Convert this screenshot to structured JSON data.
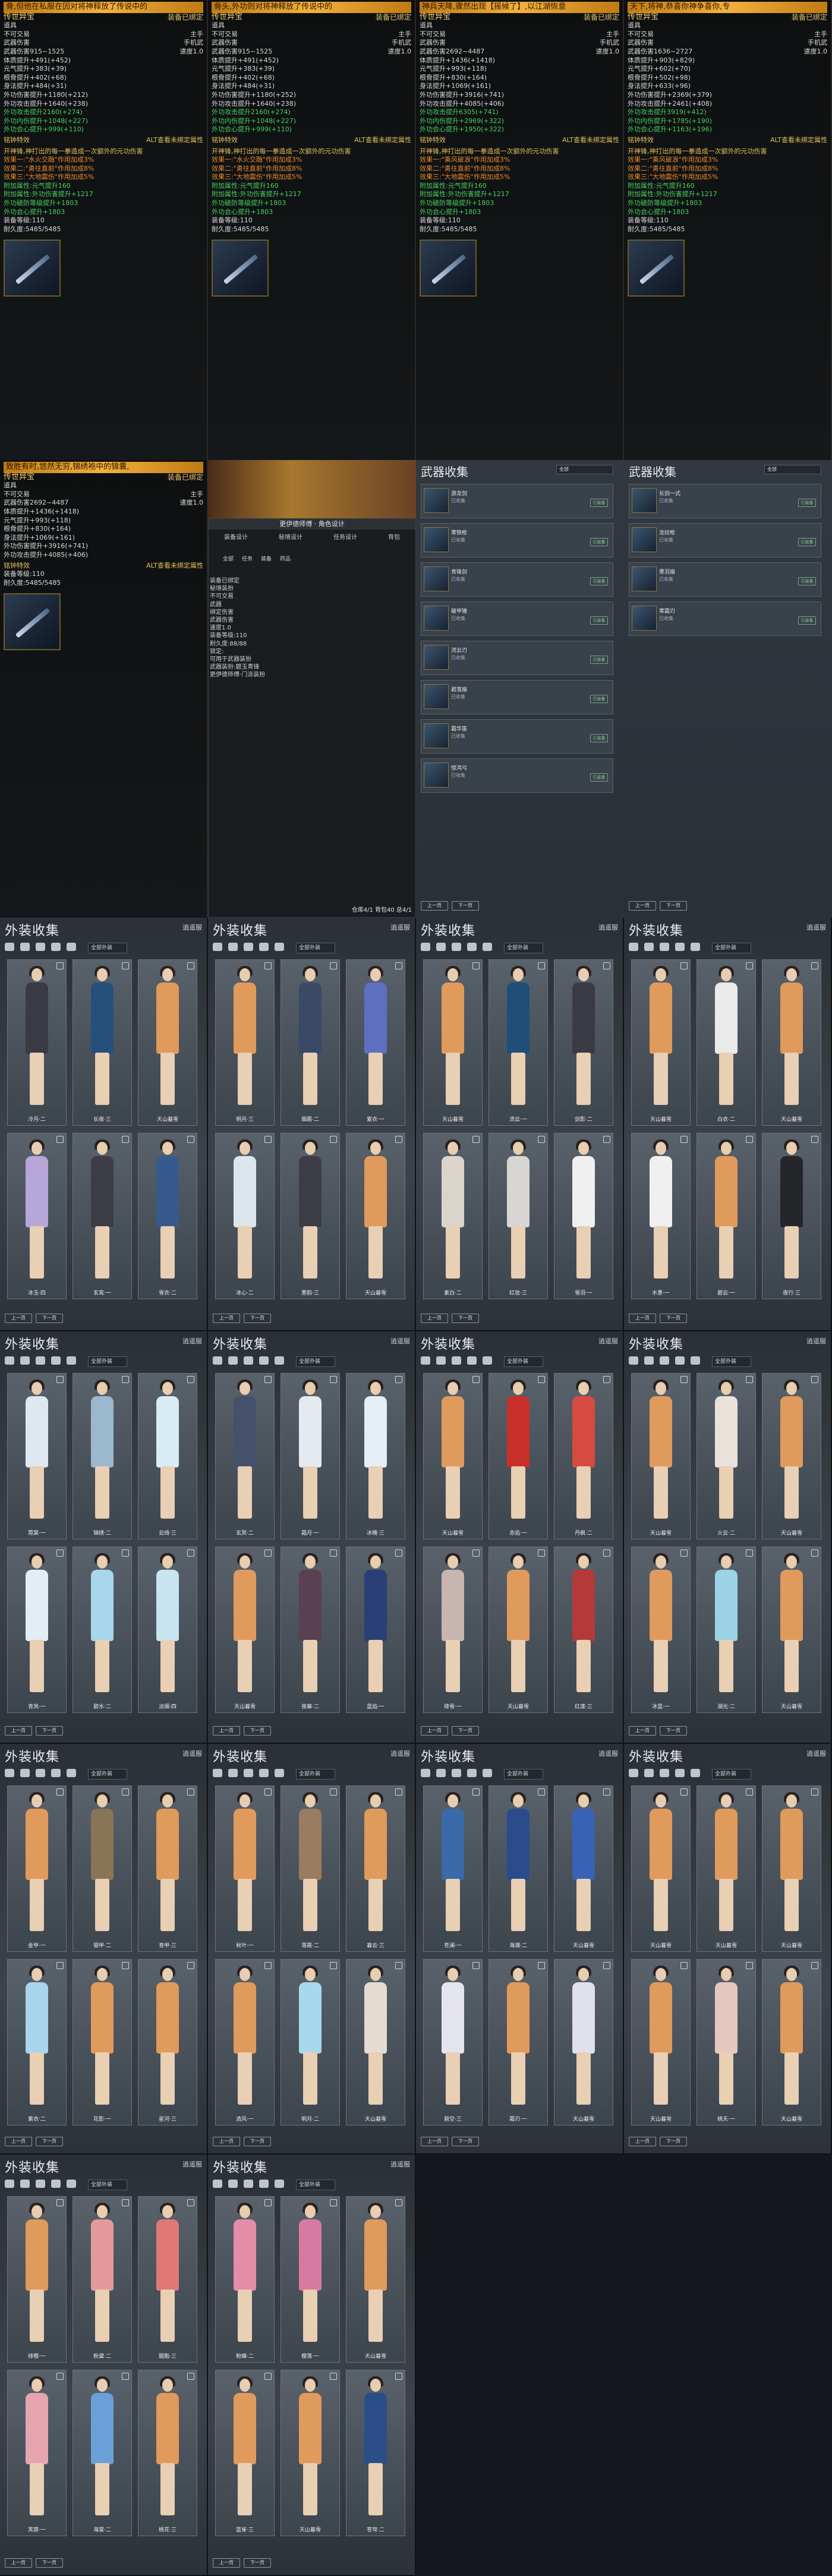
{
  "tooltips": [
    {
      "banner": "骨,但他在私服在因对将神释放了传说中的",
      "class": "传世异宝",
      "seal": "装备已绑定",
      "kind": "道具",
      "bind": "不可交易",
      "slot": "主手",
      "type": "手机武",
      "weapon_label": "武器伤害",
      "weapon_val": "武器伤害915~1525",
      "speed": "速度1.0",
      "stats": [
        "体质提升+491(+452)",
        "元气提升+383(+39)",
        "根骨提升+402(+68)",
        "身法提升+484(+31)",
        "外功伤害提升+1180(+212)",
        "外功攻击提升+1640(+238)"
      ],
      "green": [
        "外功攻击提升2160(+274)",
        "外功内伤提升+1048(+227)",
        "外功会心提升+999(+110)"
      ],
      "sect_l": "铭钟特效",
      "sect_r": "ALT查看未绑定属性",
      "desc": "开神锋,神打出的每一拳造成一次额外的元功伤害",
      "eff": [
        "效果一:\"水火交融\"作用加成3%",
        "效果二:\"勇往直前\"作用加成8%",
        "效果三:\"大地震伤\"作用加成5%"
      ],
      "attr": [
        "附加属性:元气提升160",
        "附加属性:外功伤害提升+1217",
        "外功破防等级提升+1803",
        "外功会心提升+1803"
      ],
      "dur": "耐久度:5485/5485",
      "lvl": "装备等级:110"
    },
    {
      "banner": "骨头,外功则对将神释放了传说中的",
      "class": "传世异宝",
      "seal": "装备已绑定",
      "kind": "道具",
      "bind": "不可交易",
      "slot": "主手",
      "type": "手机武",
      "weapon_label": "武器伤害",
      "weapon_val": "武器伤害915~1525",
      "speed": "速度1.0",
      "stats": [
        "体质提升+491(+452)",
        "元气提升+383(+39)",
        "根骨提升+402(+68)",
        "身法提升+484(+31)",
        "外功伤害提升+1180(+252)",
        "外功攻击提升+1640(+238)"
      ],
      "green": [
        "外功攻击提升2160(+274)",
        "外功内伤提升+1048(+227)",
        "外功会心提升+999(+110)"
      ],
      "sect_l": "铭钟特效",
      "sect_r": "ALT查看未绑定属性",
      "desc": "开神锋,神打出的每一拳造成一次额外的元功伤害",
      "eff": [
        "效果一:\"水火交融\"作用加成3%",
        "效果二:\"勇往直前\"作用加成8%",
        "效果三:\"大地震伤\"作用加成5%"
      ],
      "attr": [
        "附加属性:元气提升160",
        "附加属性:外功伤害提升+1217",
        "外功破防等级提升+1803",
        "外功会心提升+1803"
      ],
      "dur": "耐久度:5485/5485",
      "lvl": "装备等级:110"
    },
    {
      "banner": "神兵天降,骤然出现【摇候了】,以江湖恢意",
      "class": "传世异宝",
      "seal": "装备已绑定",
      "kind": "道具",
      "bind": "不可交易",
      "slot": "主手",
      "type": "手机武",
      "weapon_label": "武器伤害",
      "weapon_val": "武器伤害2692~4487",
      "speed": "速度1.0",
      "stats": [
        "体质提升+1436(+1418)",
        "元气提升+993(+118)",
        "根骨提升+830(+164)",
        "身法提升+1069(+161)",
        "外功伤害提升+3916(+741)",
        "外功攻击提升+4085(+406)"
      ],
      "green": [
        "外功攻击提升6305(+741)",
        "外功内伤提升+2969(+322)",
        "外功会心提升+1950(+322)"
      ],
      "sect_l": "铭钟特效",
      "sect_r": "ALT查看未绑定属性",
      "desc": "开神锋,神打出的每一拳造成一次额外的元功伤害",
      "eff": [
        "效果一:\"乘风破浪\"作用加成3%",
        "效果二:\"勇往直前\"作用加成8%",
        "效果三:\"大地震伤\"作用加成5%"
      ],
      "attr": [
        "附加属性:元气提升160",
        "附加属性:外功伤害提升+1217",
        "外功破防等级提升+1803",
        "外功会心提升+1803"
      ],
      "dur": "耐久度:5485/5485",
      "lvl": "装备等级:110"
    },
    {
      "banner": "天下,将神,恭喜你神争喜你,专",
      "class": "传世异宝",
      "seal": "装备已绑定",
      "kind": "道具",
      "bind": "不可交易",
      "slot": "主手",
      "type": "手机武",
      "weapon_label": "武器伤害",
      "weapon_val": "武器伤害1636~2727",
      "speed": "速度1.0",
      "stats": [
        "体质提升+903(+829)",
        "元气提升+602(+70)",
        "根骨提升+502(+98)",
        "身法提升+633(+96)",
        "外功伤害提升+2369(+379)",
        "外功攻击提升+2461(+408)"
      ],
      "green": [
        "外功攻击提升3919(+412)",
        "外功内伤提升+1785(+190)",
        "外功会心提升+1163(+196)"
      ],
      "sect_l": "铭钟特效",
      "sect_r": "ALT查看未绑定属性",
      "desc": "开神锋,神打出的每一拳造成一次额外的元功伤害",
      "eff": [
        "效果一:\"乘风破浪\"作用加成3%",
        "效果二:\"勇往直前\"作用加成8%",
        "效果三:\"大地震伤\"作用加成5%"
      ],
      "attr": [
        "附加属性:元气提升160",
        "附加属性:外功伤害提升+1217",
        "外功破防等级提升+1803",
        "外功会心提升+1803"
      ],
      "dur": "耐久度:5485/5485",
      "lvl": "装备等级:110"
    }
  ],
  "tooltip5": {
    "banner": "致胜有时,悠然无穷,锦绣袍中的锦囊,",
    "class": "传世异宝",
    "seal": "装备已绑定",
    "kind": "道具",
    "bind": "不可交易",
    "slot": "主手",
    "type": "手机武",
    "weapon_val": "武器伤害2692~4487",
    "speed": "速度1.0",
    "stats": [
      "体质提升+1436(+1418)",
      "元气提升+993(+118)",
      "根骨提升+830(+164)",
      "身法提升+1069(+161)",
      "外功伤害提升+3916(+741)",
      "外功攻击提升+4085(+406)"
    ],
    "sect_l": "铭钟特效",
    "sect_r": "ALT查看未绑定属性",
    "dur": "耐久度:5485/5485",
    "lvl": "装备等级:110"
  },
  "bag": {
    "caption": "更伊德师傅 · 角色设计",
    "tabs": [
      "装备设计",
      "秘境设计",
      "任务设计",
      "背包"
    ],
    "sub": [
      "全部",
      "任务",
      "装备",
      "药品"
    ],
    "lines": [
      "装备已绑定",
      "秘境装扮",
      "不可交易",
      "武器",
      "绑定伤害",
      "武器伤害",
      "速度1.0",
      "装备等级:110",
      "耐久度:88/88",
      "锁定:",
      "可用于武器装扮",
      "武器装扮:碧玉青锋",
      "更伊德师傅·门派装扮"
    ],
    "footer": "仓库4/1 背包40 总4/1"
  },
  "weapon_lists": [
    {
      "title": "武器收集",
      "filter": "全部",
      "items": [
        {
          "name": "游龙剑",
          "status": "已收集"
        },
        {
          "name": "寒铁枪",
          "status": "已收集"
        },
        {
          "name": "青锋剑",
          "status": "已收集"
        },
        {
          "name": "破甲锤",
          "status": "已收集"
        },
        {
          "name": "流云刃",
          "status": "已收集"
        },
        {
          "name": "碧落扇",
          "status": "已收集"
        },
        {
          "name": "霜华笛",
          "status": "已收集"
        },
        {
          "name": "惊鸿弓",
          "status": "已收集"
        }
      ],
      "btn": "已装备",
      "prev": "上一页",
      "next": "下一页"
    },
    {
      "title": "武器收集",
      "filter": "全部",
      "items": [
        {
          "name": "长剑一式",
          "status": "已收集"
        },
        {
          "name": "龙纹枪",
          "status": "已收集"
        },
        {
          "name": "墨羽扇",
          "status": "已收集"
        },
        {
          "name": "寒霜刃",
          "status": "已收集"
        }
      ],
      "btn": "已装备",
      "prev": "上一页",
      "next": "下一页"
    }
  ],
  "outfit_panels": [
    {
      "title": "外装收集",
      "btn": "逍遥服",
      "filter": "全部外装",
      "names": [
        "冷月·二",
        "长夜·三",
        "天山暮雪",
        "冰玉·四",
        "玄鸾·一",
        "雪衣·二"
      ],
      "colors": [
        "#3a3a44",
        "#26507c",
        "#e09a5c",
        "#b7a7d8",
        "#3c3c44",
        "#365a8e"
      ],
      "prev": "上一页",
      "next": "下一页"
    },
    {
      "title": "外装收集",
      "btn": "逍遥服",
      "filter": "全部外装",
      "names": [
        "明月·三",
        "烟霞·二",
        "紫衣·一",
        "冰心·二",
        "墨韵·三",
        "天山暮雪"
      ],
      "colors": [
        "#e09a5c",
        "#3a4a66",
        "#5f6fbf",
        "#dce4ec",
        "#3c3c44",
        "#e09a5c"
      ],
      "prev": "上一页",
      "next": "下一页"
    },
    {
      "title": "外装收集",
      "btn": "逍遥服",
      "filter": "全部外装",
      "names": [
        "天山暮雪",
        "流云·一",
        "剑影·二",
        "素白·二",
        "红妆·三",
        "雪羽·一"
      ],
      "colors": [
        "#e09a5c",
        "#1f4f78",
        "#3a3a44",
        "#dad4cc",
        "#d8d6d2",
        "#f0f0f0"
      ],
      "prev": "上一页",
      "next": "下一页"
    },
    {
      "title": "外装收集",
      "btn": "逍遥服",
      "filter": "全部外装",
      "names": [
        "天山暮雪",
        "白衣·二",
        "天山暮雪",
        "水墨·一",
        "碧云·一",
        "夜行·三"
      ],
      "colors": [
        "#e09a5c",
        "#eaeaea",
        "#e09a5c",
        "#f0f0f0",
        "#e09a5c",
        "#24262a"
      ],
      "prev": "上一页",
      "next": "下一页"
    },
    {
      "title": "外装收集",
      "btn": "逍遥服",
      "filter": "全部外装",
      "names": [
        "霓裳·一",
        "锦绣·二",
        "云绮·三",
        "青岚·一",
        "碧水·二",
        "淡烟·四"
      ],
      "colors": [
        "#dfe8f0",
        "#9cb8cc",
        "#d8ecf4",
        "#e4ecf4",
        "#a8d6ea",
        "#c8e4f0"
      ],
      "prev": "上一页",
      "next": "下一页"
    },
    {
      "title": "外装收集",
      "btn": "逍遥服",
      "filter": "全部外装",
      "names": [
        "玄冥·二",
        "霜月·一",
        "冰魄·三",
        "天山暮雪",
        "夜幕·二",
        "蓝焰·一"
      ],
      "colors": [
        "#45506a",
        "#e4eaf0",
        "#e4eef4",
        "#e09a5c",
        "#5a4050",
        "#2a3e78"
      ],
      "prev": "上一页",
      "next": "下一页"
    },
    {
      "title": "外装收集",
      "btn": "逍遥服",
      "filter": "全部外装",
      "names": [
        "天山暮雪",
        "赤焰·一",
        "丹枫·二",
        "绛雪·一",
        "天山暮雪",
        "红莲·三"
      ],
      "colors": [
        "#e09a5c",
        "#c8302c",
        "#d64a40",
        "#c8b4b0",
        "#e09a5c",
        "#b43a3a"
      ],
      "prev": "上一页",
      "next": "下一页"
    },
    {
      "title": "外装收集",
      "btn": "逍遥服",
      "filter": "全部外装",
      "names": [
        "天山暮雪",
        "火云·二",
        "天山暮雪",
        "冰蓝·一",
        "湖光·二",
        "天山暮雪"
      ],
      "colors": [
        "#e09a5c",
        "#e8e2da",
        "#e09a5c",
        "#e09a5c",
        "#9cd2e6",
        "#e09a5c"
      ],
      "prev": "上一页",
      "next": "下一页"
    },
    {
      "title": "外装收集",
      "btn": "逍遥服",
      "filter": "全部外装",
      "names": [
        "金甲·一",
        "银甲·二",
        "青甲·三",
        "紫衣·二",
        "花影·一",
        "星河·三"
      ],
      "colors": [
        "#e09a5c",
        "#8a7458",
        "#e09a5c",
        "#a8d4ec",
        "#e09a5c",
        "#e09a5c"
      ],
      "prev": "上一页",
      "next": "下一页"
    },
    {
      "title": "外装收集",
      "btn": "逍遥服",
      "filter": "全部外装",
      "names": [
        "秋叶·一",
        "落霞·二",
        "暮云·三",
        "清风·一",
        "明月·二",
        "天山暮雪"
      ],
      "colors": [
        "#e09a5c",
        "#9a7c60",
        "#e09a5c",
        "#e09a5c",
        "#a8d8ec",
        "#e4dcd0"
      ],
      "prev": "上一页",
      "next": "下一页"
    },
    {
      "title": "外装收集",
      "btn": "逍遥服",
      "filter": "全部外装",
      "names": [
        "苍澜·一",
        "海潮·二",
        "天山暮雪",
        "碧空·三",
        "霜刃·一",
        "天山暮雪"
      ],
      "colors": [
        "#3a6aa8",
        "#2a4c8c",
        "#3862b4",
        "#e4e4ec",
        "#e09a5c",
        "#e0e0ea"
      ],
      "prev": "上一页",
      "next": "下一页"
    },
    {
      "title": "外装收集",
      "btn": "逍遥服",
      "filter": "全部外装",
      "names": [
        "天山暮雪",
        "天山暮雪",
        "天山暮雪",
        "天山暮雪",
        "桃夭·一",
        "天山暮雪"
      ],
      "colors": [
        "#e09a5c",
        "#e09a5c",
        "#e09a5c",
        "#e09a5c",
        "#e4c8c0",
        "#e09a5c"
      ],
      "prev": "上一页",
      "next": "下一页"
    },
    {
      "title": "外装收集",
      "btn": "逍遥服",
      "filter": "全部外装",
      "names": [
        "绯樱·一",
        "粉黛·二",
        "胭脂·三",
        "芙蓉·一",
        "海棠·二",
        "桃花·三"
      ],
      "colors": [
        "#e09a5c",
        "#e49a9a",
        "#e07878",
        "#e6a4b0",
        "#6aa0d8",
        "#e09a5c"
      ],
      "prev": "上一页",
      "next": "下一页"
    },
    {
      "title": "外装收集",
      "btn": "逍遥服",
      "filter": "全部外装",
      "names": [
        "粉蝶·二",
        "樱落·一",
        "天山暮雪",
        "蓝雀·三",
        "天山暮雪",
        "苍穹·二"
      ],
      "colors": [
        "#e48ca8",
        "#d87aa0",
        "#e09a5c",
        "#e09a5c",
        "#e09a5c",
        "#2a4e88"
      ],
      "prev": "上一页",
      "next": "下一页"
    }
  ]
}
